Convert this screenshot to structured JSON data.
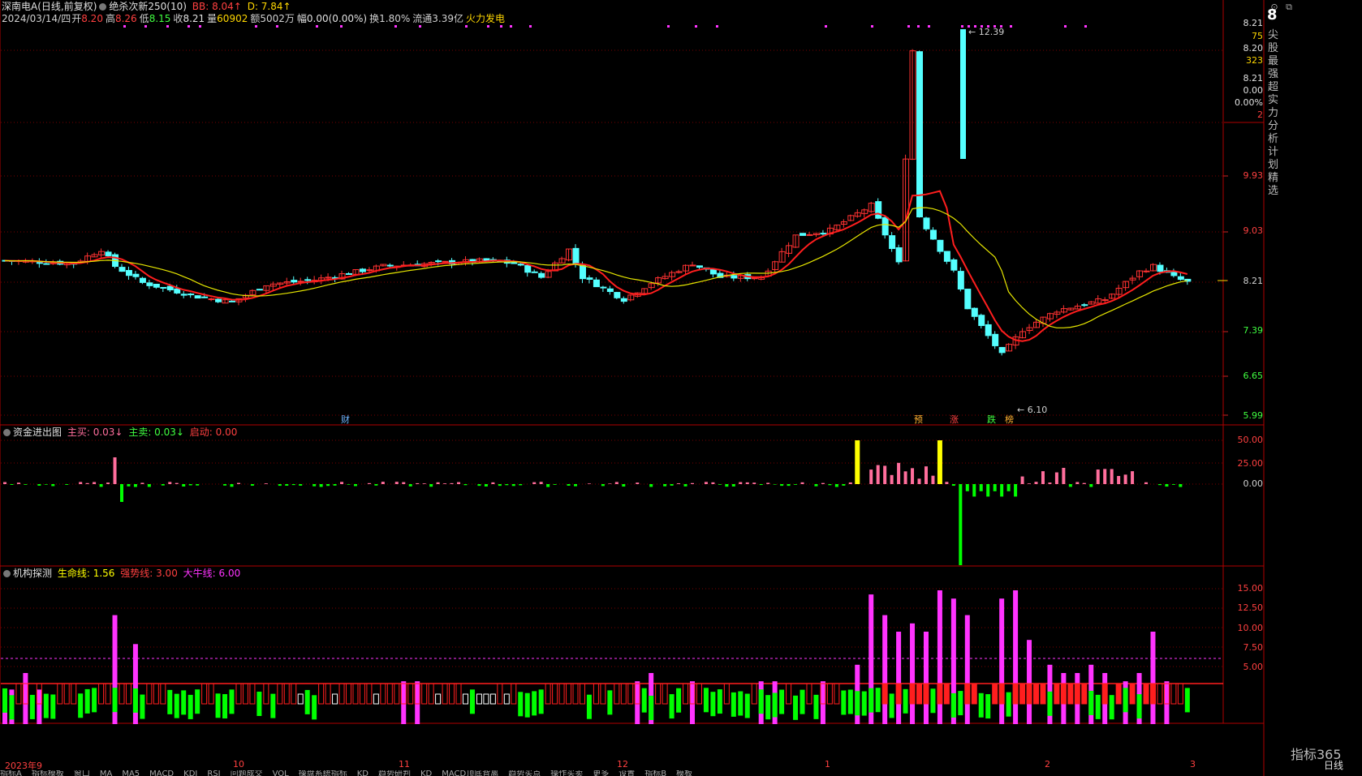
{
  "header": {
    "stock_name": "深南电A(日线,前复权)",
    "indicator_name": "绝杀次新250(10)",
    "bb_label": "BB: 8.04↑",
    "d_label": "D: 7.84↑",
    "date": "2024/03/14/四",
    "open_label": "开",
    "open_value": "8.20",
    "high_label": "高",
    "high_value": "8.26",
    "low_label": "低",
    "low_value": "8.15",
    "close_label": "收",
    "close_value": "8.21",
    "volume_label": "量",
    "volume_value": "60902",
    "amount": "额5002万",
    "amplitude": "幅0.00(0.00%)",
    "turnover": "换1.80%",
    "float_cap": "流通3.39亿",
    "sector": "火力发电"
  },
  "colors": {
    "up": "#ff3232",
    "down": "#54ffff",
    "ma_red": "#ff1e1e",
    "ma_yellow": "#e6e600",
    "border": "#b00000",
    "magenta": "#ff33ff",
    "green_bar": "#00ff00",
    "pink_bar": "#ff6e9c",
    "yellow_bar": "#ffff00"
  },
  "main_chart": {
    "price_axis": [
      "9.93",
      "9.03",
      "8.21",
      "7.39",
      "6.65",
      "5.99"
    ],
    "max_label": "12.39",
    "min_label": "6.10",
    "right_info": [
      "8.21",
      "75",
      "8.20",
      "323",
      "8.21",
      "0.00",
      "0.00%",
      "2"
    ],
    "event_marks": [
      {
        "text": "财",
        "color": "#6fb4ff"
      },
      {
        "text": "预",
        "color": "#ffb030"
      },
      {
        "text": "涨",
        "color": "#ff4040"
      },
      {
        "text": "跌",
        "color": "#40ff40"
      },
      {
        "text": "榜",
        "color": "#ffb030"
      }
    ],
    "side_panel_glyph": "8",
    "side_panel_text": "尖股最强超实力分析计划精选"
  },
  "fund_panel": {
    "title": "资金进出图",
    "buy_label": "主买: 0.03↓",
    "sell_label": "主卖: 0.03↓",
    "start_label": "启动: 0.00",
    "axis": [
      "50.00",
      "25.00",
      "0.00"
    ]
  },
  "inst_panel": {
    "title": "机构探测",
    "life_label": "生命线: 1.56",
    "strong_label": "强势线: 3.00",
    "bull_label": "大牛线: 6.00",
    "axis": [
      "15.00",
      "12.50",
      "10.00",
      "7.50",
      "5.00"
    ]
  },
  "time_axis": {
    "labels": [
      "2023年9",
      "10",
      "11",
      "12",
      "1",
      "2",
      "3"
    ],
    "period": "日线"
  },
  "bottom_tabs": [
    "指标A",
    "指标模板",
    "窗口",
    "MA",
    "MA5",
    "MACD",
    "KDJ",
    "RSI",
    "问题成交",
    "VOL",
    "操盘系统指标",
    "KD",
    "趋势研判",
    "KD",
    "MACD顶底背离",
    "趋势买点",
    "操作买卖",
    "更多",
    "设置",
    "指标B",
    "模板"
  ],
  "watermark": "指标365"
}
